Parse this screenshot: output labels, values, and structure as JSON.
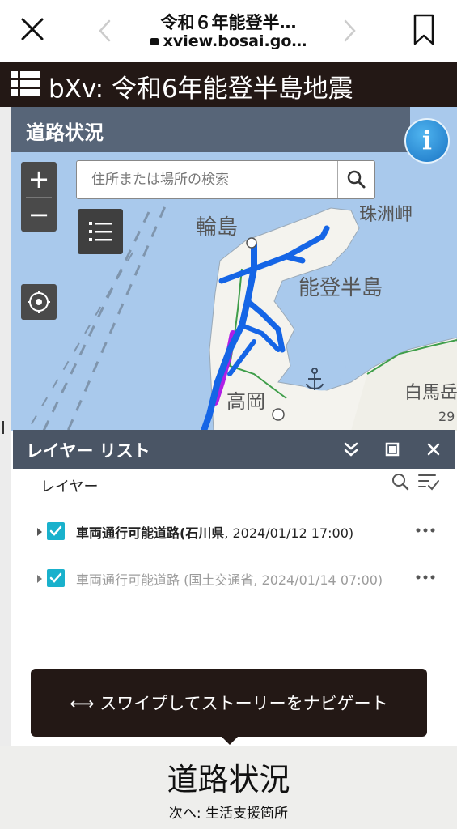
{
  "browser": {
    "title": "令和６年能登半…",
    "url": "xview.bosai.go…"
  },
  "app": {
    "title": "bXv: 令和6年能登半島地震"
  },
  "map": {
    "section_title": "道路状況",
    "search_placeholder": "住所または場所の検索",
    "labels": {
      "wajima": "輪島",
      "suzu": "珠洲岬",
      "noto": "能登半島",
      "takaoka": "高岡",
      "shirouma": "白馬岳",
      "elevation": "29"
    },
    "zoom_in": "+",
    "zoom_out": "−",
    "info": "i",
    "colors": {
      "sea": "#a9c9ec",
      "land": "#f4f3ee",
      "road_open": "#1565e6",
      "road_alt": "#b01ee6"
    }
  },
  "layer_panel": {
    "title": "レイヤー リスト",
    "layers_label": "レイヤー",
    "layers": [
      {
        "name": "車両通行可能道路(石川県",
        "meta": ", 2024/01/12 17:00)",
        "checked": true
      },
      {
        "name": "車両通行可能道路 (国土交通省",
        "meta": ", 2024/01/14 07:00)",
        "checked": true
      }
    ]
  },
  "swipe_hint": {
    "text": "⟷ スワイプしてストーリーをナビゲート"
  },
  "story": {
    "title": "道路状況",
    "next": "次へ: 生活支援箇所"
  },
  "icons": {
    "close": "close-icon",
    "back": "chevron-left-icon",
    "forward": "chevron-right-icon",
    "bookmark": "bookmark-icon",
    "menu": "grid-menu-icon",
    "search": "search-icon",
    "legend": "list-icon",
    "locate": "locate-icon",
    "collapse": "double-chevron-down-icon",
    "maximize": "maximize-icon",
    "panel_close": "close-icon",
    "filter": "filter-icon",
    "more": "more-dots-icon",
    "anchor": "anchor-icon"
  }
}
